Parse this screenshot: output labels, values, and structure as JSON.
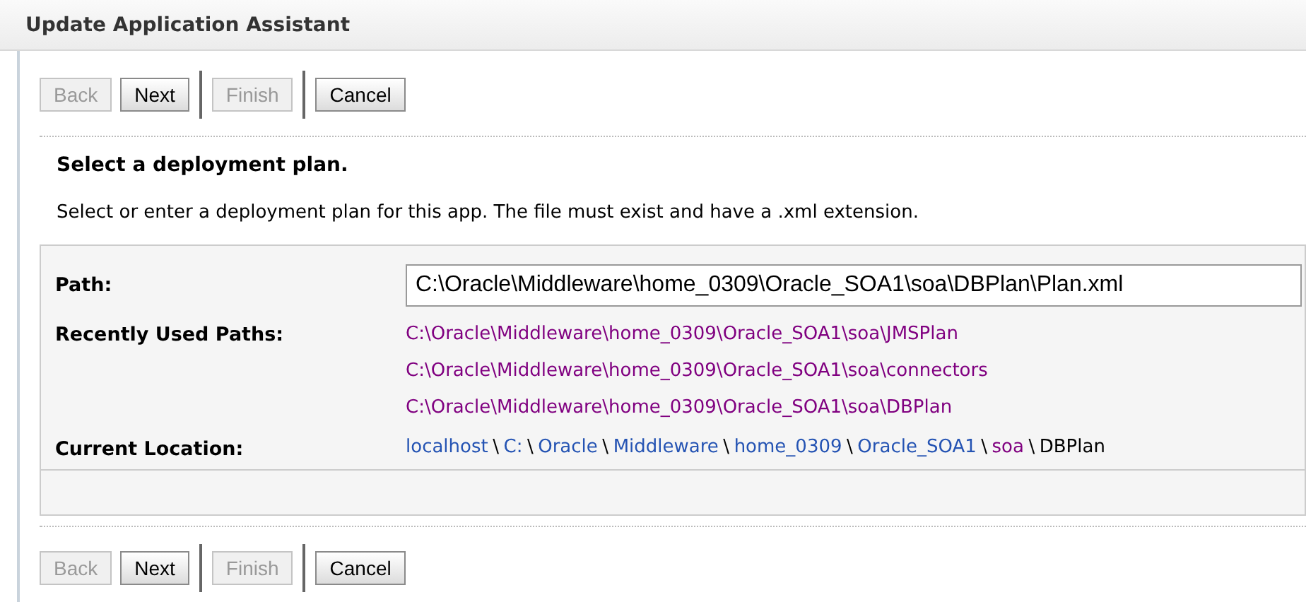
{
  "window": {
    "title": "Update Application Assistant"
  },
  "top_toolbar": [
    {
      "label": "Back",
      "disabled": true
    },
    {
      "label": "Next",
      "disabled": false
    },
    {
      "label": "Finish",
      "disabled": true
    },
    {
      "label": "Cancel",
      "disabled": false
    }
  ],
  "heading": "Select a deployment plan.",
  "description": "Select or enter a deployment plan for this app. The file must exist and have a .xml extension.",
  "form": {
    "path_label": "Path:",
    "path_value": "C:\\Oracle\\Middleware\\home_0309\\Oracle_SOA1\\soa\\DBPlan\\Plan.xml",
    "recent_label": "Recently Used Paths:",
    "recent_paths": [
      {
        "text": "C:\\Oracle\\Middleware\\home_0309\\Oracle_SOA1\\soa\\JMSPlan",
        "visited": true
      },
      {
        "text": "C:\\Oracle\\Middleware\\home_0309\\Oracle_SOA1\\soa\\connectors",
        "visited": true
      },
      {
        "text": "C:\\Oracle\\Middleware\\home_0309\\Oracle_SOA1\\soa\\DBPlan",
        "visited": true
      }
    ],
    "location_label": "Current Location:",
    "breadcrumb": [
      {
        "text": "localhost",
        "kind": "link",
        "visited": false
      },
      {
        "text": "C:",
        "kind": "link",
        "visited": false
      },
      {
        "text": "Oracle",
        "kind": "link",
        "visited": false
      },
      {
        "text": "Middleware",
        "kind": "link",
        "visited": false
      },
      {
        "text": "home_0309",
        "kind": "link",
        "visited": false
      },
      {
        "text": "Oracle_SOA1",
        "kind": "link",
        "visited": false
      },
      {
        "text": "soa",
        "kind": "link",
        "visited": true
      },
      {
        "text": "DBPlan",
        "kind": "current"
      }
    ],
    "separator": "\\"
  },
  "bottom_toolbar": [
    {
      "label": "Back",
      "disabled": true
    },
    {
      "label": "Next",
      "disabled": false
    },
    {
      "label": "Finish",
      "disabled": true
    },
    {
      "label": "Cancel",
      "disabled": false
    }
  ]
}
